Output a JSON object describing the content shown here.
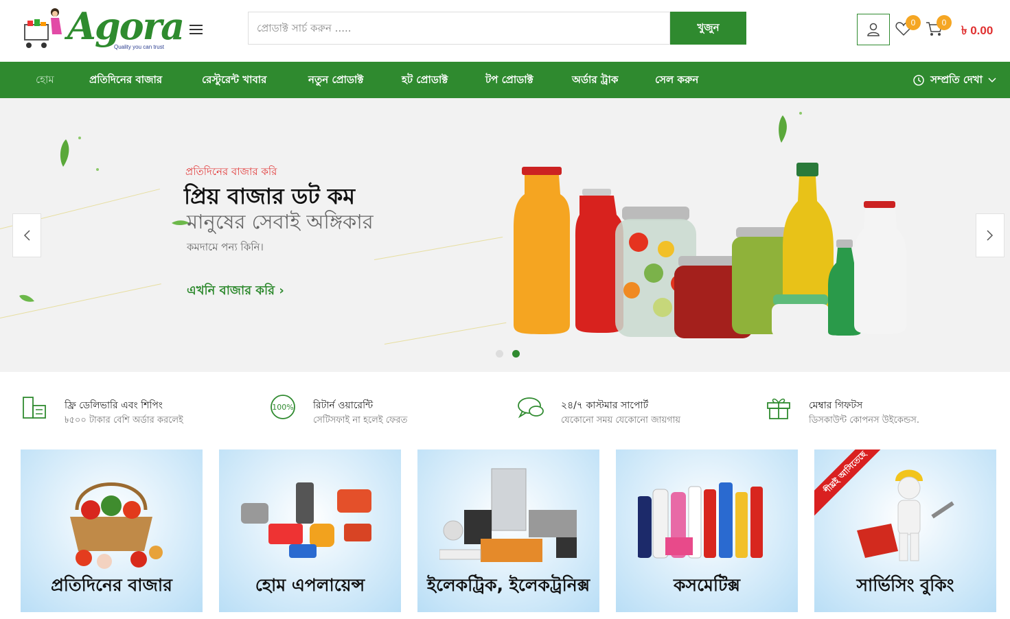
{
  "header": {
    "logo_text": "Agora",
    "logo_tagline": "Quality you can trust",
    "search_placeholder": "প্রোডাক্ট সার্চ করুন .....",
    "search_button": "খুজুন",
    "wishlist_count": "0",
    "cart_count": "0",
    "cart_total": "৳ 0.00",
    "icons": [
      "menu-icon",
      "user-icon",
      "heart-icon",
      "cart-icon"
    ]
  },
  "nav": {
    "items": [
      {
        "label": "হোম"
      },
      {
        "label": "প্রতিদিনের বাজার"
      },
      {
        "label": "রেস্টুরেন্ট খাবার"
      },
      {
        "label": "নতুন প্রোডাক্ট"
      },
      {
        "label": "হট প্রোডাক্ট"
      },
      {
        "label": "টপ প্রোডাক্ট"
      },
      {
        "label": "অর্ডার ট্রাক"
      },
      {
        "label": "সেল করুন"
      }
    ],
    "recent_label": "সম্প্রতি দেখা"
  },
  "hero": {
    "subtitle": "প্রতিদিনের বাজার করি",
    "title": "প্রিয় বাজার ডট কম",
    "title2": "মানুষের সেবাই অঙ্গিকার",
    "description": "কমদামে পন্য কিনি।",
    "cta": "এখনি বাজার করি ›",
    "active_slide": 2,
    "slide_count": 2
  },
  "features": [
    {
      "icon": "delivery-icon",
      "title": "ফ্রি ডেলিভারি এবং শিপিং",
      "subtitle": "৳৫০০ টাকার বেশি অর্ডার করলেই"
    },
    {
      "icon": "warranty-icon",
      "title": "রিটার্ন ওয়ারেন্টি",
      "subtitle": "সেটিসফাই না হলেই ফেরত"
    },
    {
      "icon": "chat-icon",
      "title": "২৪/৭ কাস্টমার সাপোর্ট",
      "subtitle": "যেকোনো সময় যেকোনো জায়গায়"
    },
    {
      "icon": "gift-icon",
      "title": "মেম্বার গিফটস",
      "subtitle": "ডিসকাউন্ট কোপনস উইকেন্ডস."
    }
  ],
  "categories": [
    {
      "label": "প্রতিদিনের বাজার"
    },
    {
      "label": "হোম এপলায়েন্স"
    },
    {
      "label": "ইলেকট্রিক, ইলেকট্রনিক্স"
    },
    {
      "label": "কসমেটিক্স"
    },
    {
      "label": "সার্ভিসিং বুকিং",
      "ribbon": "শীঘ্রই আসিতেছে"
    }
  ],
  "colors": {
    "brand_green": "#2f8a2f",
    "price_red": "#e03030",
    "badge_orange": "#f5a623"
  }
}
